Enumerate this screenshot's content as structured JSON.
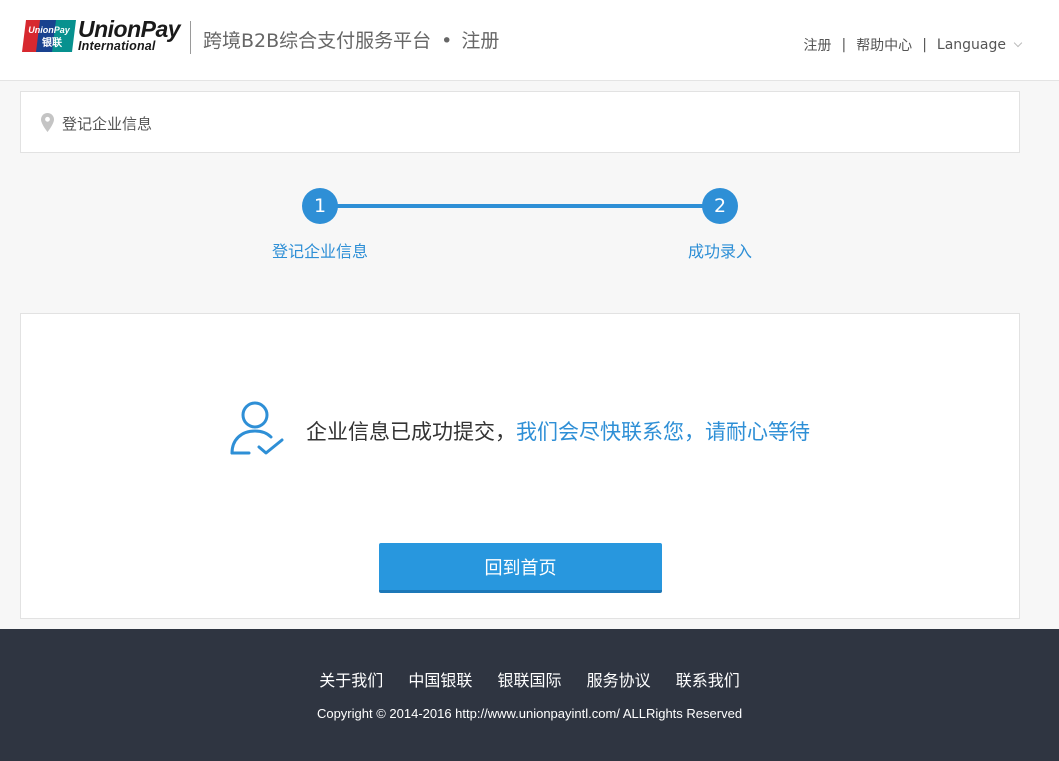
{
  "header": {
    "logo_text_1": "UnionPay",
    "logo_text_2": "International",
    "logo_mark_text_1": "UnionPay",
    "logo_mark_text_2": "银联",
    "title": "跨境B2B综合支付服务平台",
    "title_dot": "•",
    "title_suffix": "注册",
    "links": {
      "register": "注册",
      "help": "帮助中心",
      "language": "Language",
      "separator": "|"
    }
  },
  "breadcrumb": {
    "icon": "location-pin-icon",
    "text": "登记企业信息"
  },
  "steps": [
    {
      "number": "1",
      "label": "登记企业信息"
    },
    {
      "number": "2",
      "label": "成功录入"
    }
  ],
  "result": {
    "icon": "user-check-icon",
    "message_part1": "企业信息已成功提交，",
    "message_part2": "我们会尽快联系您，请耐心等待",
    "button_label": "回到首页"
  },
  "footer": {
    "links": [
      "关于我们",
      "中国银联",
      "银联国际",
      "服务协议",
      "联系我们"
    ],
    "copyright": "Copyright © 2014-2016 http://www.unionpayintl.com/ ALLRights Reserved"
  },
  "colors": {
    "accent": "#2e8fd6",
    "button": "#2897de",
    "footer_bg": "#2f3541",
    "logo_red": "#d7282f",
    "logo_blue": "#19428f",
    "logo_green": "#07918f"
  }
}
